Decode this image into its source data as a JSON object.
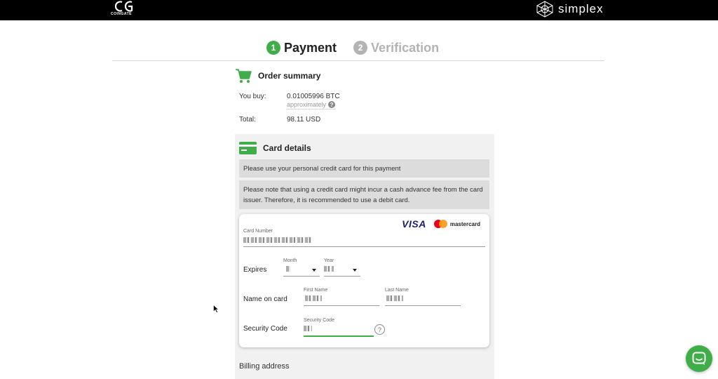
{
  "header": {
    "left_logo_text": "COINGATE",
    "right_logo_text": "simplex"
  },
  "steps": [
    {
      "number": "1",
      "label": "Payment",
      "state": "active"
    },
    {
      "number": "2",
      "label": "Verification",
      "state": "inactive"
    }
  ],
  "order_summary": {
    "title": "Order summary",
    "you_buy_label": "You buy:",
    "you_buy_value": "0.01005996 BTC",
    "approx_label": "approximately",
    "total_label": "Total:",
    "total_value": "98.11 USD"
  },
  "card_details": {
    "title": "Card details",
    "notice_personal": "Please use your personal credit card for this payment",
    "notice_fee": "Please note that using a credit card might incur a cash advance fee from the card issuer. Therefore, it is recommended to use a debit card.",
    "brand_visa": "VISA",
    "brand_mastercard": "mastercard",
    "card_number_label": "Card Number",
    "expires_label": "Expires",
    "month_label": "Month",
    "year_label": "Year",
    "name_on_card_label": "Name on card",
    "first_name_label": "First Name",
    "last_name_label": "Last Name",
    "security_code_row_label": "Security Code",
    "security_code_field_label": "Security Code",
    "help_glyph": "?"
  },
  "billing": {
    "label": "Billing address"
  },
  "colors": {
    "accent": "#3fae49",
    "inactive": "#b3b3b3",
    "topbar": "#000000"
  }
}
